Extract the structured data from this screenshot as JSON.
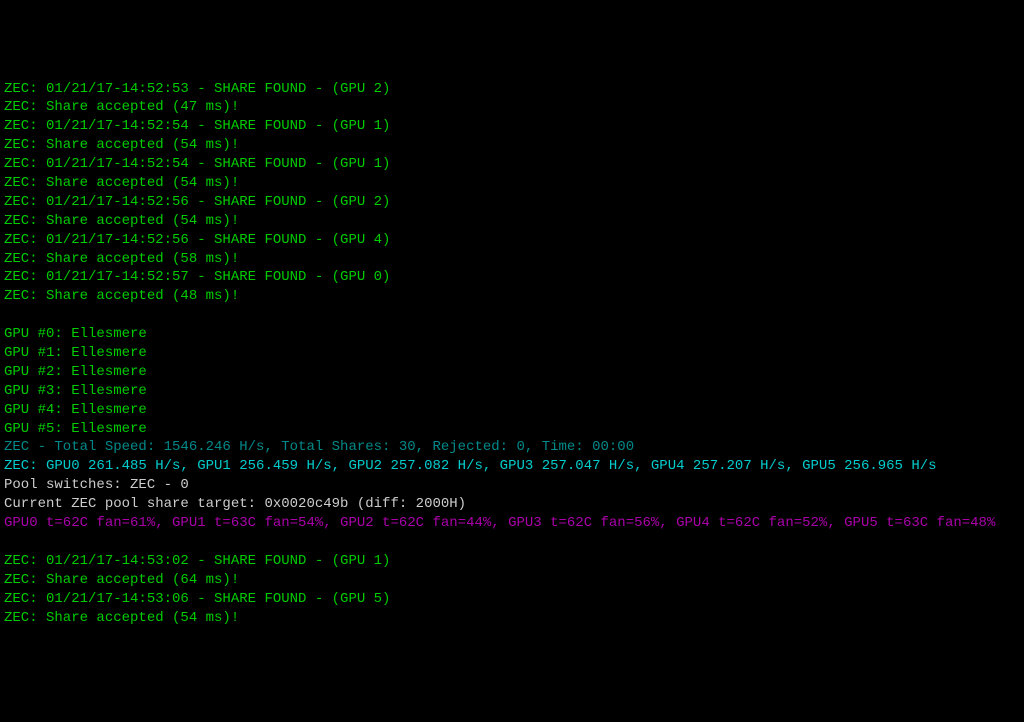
{
  "lines": [
    {
      "cls": "green",
      "text": "ZEC: 01/21/17-14:52:53 - SHARE FOUND - (GPU 2)"
    },
    {
      "cls": "green",
      "text": "ZEC: Share accepted (47 ms)!"
    },
    {
      "cls": "green",
      "text": "ZEC: 01/21/17-14:52:54 - SHARE FOUND - (GPU 1)"
    },
    {
      "cls": "green",
      "text": "ZEC: Share accepted (54 ms)!"
    },
    {
      "cls": "green",
      "text": "ZEC: 01/21/17-14:52:54 - SHARE FOUND - (GPU 1)"
    },
    {
      "cls": "green",
      "text": "ZEC: Share accepted (54 ms)!"
    },
    {
      "cls": "green",
      "text": "ZEC: 01/21/17-14:52:56 - SHARE FOUND - (GPU 2)"
    },
    {
      "cls": "green",
      "text": "ZEC: Share accepted (54 ms)!"
    },
    {
      "cls": "green",
      "text": "ZEC: 01/21/17-14:52:56 - SHARE FOUND - (GPU 4)"
    },
    {
      "cls": "green",
      "text": "ZEC: Share accepted (58 ms)!"
    },
    {
      "cls": "green",
      "text": "ZEC: 01/21/17-14:52:57 - SHARE FOUND - (GPU 0)"
    },
    {
      "cls": "green",
      "text": "ZEC: Share accepted (48 ms)!"
    },
    {
      "cls": "green",
      "text": " "
    },
    {
      "cls": "green",
      "text": "GPU #0: Ellesmere"
    },
    {
      "cls": "green",
      "text": "GPU #1: Ellesmere"
    },
    {
      "cls": "green",
      "text": "GPU #2: Ellesmere"
    },
    {
      "cls": "green",
      "text": "GPU #3: Ellesmere"
    },
    {
      "cls": "green",
      "text": "GPU #4: Ellesmere"
    },
    {
      "cls": "green",
      "text": "GPU #5: Ellesmere"
    },
    {
      "cls": "teal",
      "text": "ZEC - Total Speed: 1546.246 H/s, Total Shares: 30, Rejected: 0, Time: 00:00"
    },
    {
      "cls": "cyan",
      "text": "ZEC: GPU0 261.485 H/s, GPU1 256.459 H/s, GPU2 257.082 H/s, GPU3 257.047 H/s, GPU4 257.207 H/s, GPU5 256.965 H/s"
    },
    {
      "cls": "white",
      "text": "Pool switches: ZEC - 0"
    },
    {
      "cls": "white",
      "text": "Current ZEC pool share target: 0x0020c49b (diff: 2000H)"
    },
    {
      "cls": "magenta",
      "text": "GPU0 t=62C fan=61%, GPU1 t=63C fan=54%, GPU2 t=62C fan=44%, GPU3 t=62C fan=56%, GPU4 t=62C fan=52%, GPU5 t=63C fan=48%"
    },
    {
      "cls": "green",
      "text": " "
    },
    {
      "cls": "green",
      "text": "ZEC: 01/21/17-14:53:02 - SHARE FOUND - (GPU 1)"
    },
    {
      "cls": "green",
      "text": "ZEC: Share accepted (64 ms)!"
    },
    {
      "cls": "green",
      "text": "ZEC: 01/21/17-14:53:06 - SHARE FOUND - (GPU 5)"
    },
    {
      "cls": "green",
      "text": "ZEC: Share accepted (54 ms)!"
    }
  ]
}
